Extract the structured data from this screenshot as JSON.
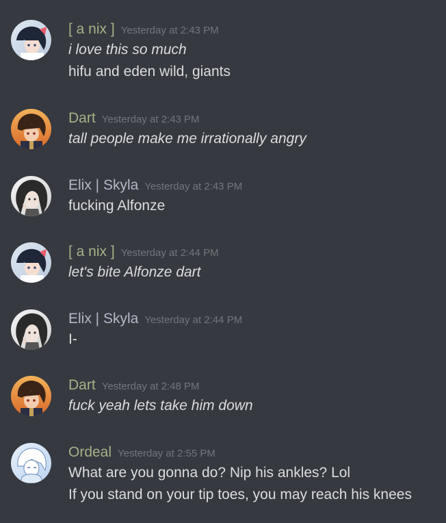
{
  "messages": [
    {
      "author": "[ a nix ]",
      "timestamp": "Yesterday at 2:43 PM",
      "lines": [
        "i love this so much",
        "hifu and eden wild, giants"
      ]
    },
    {
      "author": "Dart",
      "timestamp": "Yesterday at 2:43 PM",
      "lines": [
        "tall people make me irrationally angry"
      ]
    },
    {
      "author": "Elix | Skyla",
      "timestamp": "Yesterday at 2:43 PM",
      "lines": [
        "fucking Alfonze"
      ]
    },
    {
      "author": "[ a nix ]",
      "timestamp": "Yesterday at 2:44 PM",
      "lines": [
        "let's bite Alfonze dart"
      ]
    },
    {
      "author": "Elix | Skyla",
      "timestamp": "Yesterday at 2:44 PM",
      "lines": [
        "I-"
      ]
    },
    {
      "author": "Dart",
      "timestamp": "Yesterday at 2:48 PM",
      "lines": [
        "fuck yeah lets take him down"
      ]
    },
    {
      "author": "Ordeal",
      "timestamp": "Yesterday at 2:55 PM",
      "lines": [
        "What are you gonna do? Nip his ankles? Lol",
        "If you stand on your tip toes, you may reach his knees"
      ]
    }
  ]
}
